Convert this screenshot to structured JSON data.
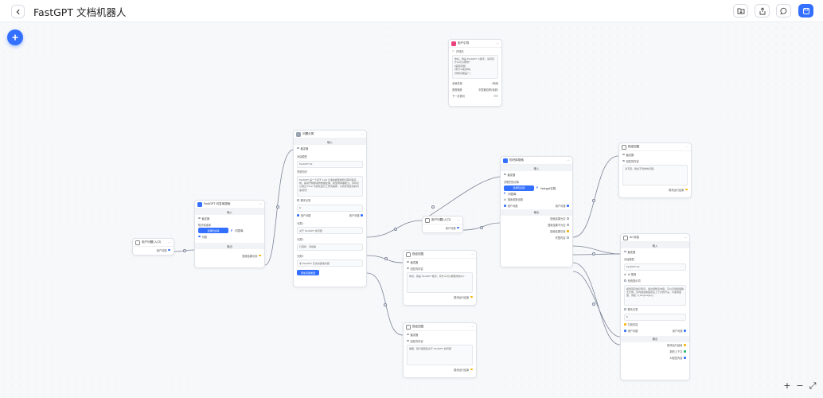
{
  "header": {
    "back_icon": "chevron-left-icon",
    "title": "FastGPT 文档机器人"
  },
  "toolbar": {
    "icons": [
      "folder-import-icon",
      "export-icon",
      "chat-icon",
      "save-icon"
    ]
  },
  "fab": {
    "icon": "plus-icon",
    "label": "+"
  },
  "nodes": {
    "user_guide": {
      "title": "用户引导",
      "greeting_label": "开场白",
      "greeting_text": "你好，我是 FastGPT 小助手，请问有什么可以帮你？\n[使用问题]\n[有什么新的吗]\n[你的功能是？]",
      "vars_label": "全局变量",
      "vars_value": "+新增",
      "tts_label": "语音播放",
      "tts_value": "浏览器自带(免费)",
      "next_label": "下一步提问"
    },
    "user_q_1": {
      "title": "用户问题(入口)",
      "out_label": "用户问题"
    },
    "kb_search_1": {
      "title": "FastGPT 问答库搜索",
      "input_section": "输入",
      "trigger_label": "触发器",
      "kb_label": "知识库选择",
      "kb_button": "选择知识库",
      "kb_tag": "问答库",
      "question_label": "问题",
      "output_section": "输出",
      "out_label": "搜索结果引用"
    },
    "classifier": {
      "title": "问题分类",
      "input_section": "输入",
      "trigger_label": "触发器",
      "model_label": "对话模型",
      "model_value": "FastGPT-4k",
      "bg_label": "背景知识",
      "bg_text": "FastGPT 是一个基于 LLM 大语言模型的知识库问答系统，提供开箱即用的数据处理、模型调用等能力。同时可以通过 Flow 可视化进行工作流编排，从而实现复杂的问答场景！",
      "history_label": "聊天记录",
      "history_value": "6",
      "question_label": "用户问题",
      "question_out": "用户问题",
      "class_label": "分类1",
      "class1": "关于 FastGPT 的问题",
      "class2_label": "分类2",
      "class2": "打招呼、问候等",
      "class3_label": "分类3",
      "class3": "非 FastGPT 无关的其他问题",
      "add_button": "添加问题类型"
    },
    "user_q_2": {
      "title": "用户问题(入口)",
      "out_label": "用户问题"
    },
    "reply_1": {
      "title": "指定回复",
      "trigger_label": "触发器",
      "content_label": "回复的内容",
      "content": "你好，我是 FastGPT 助手，有什么可以帮助你的么？",
      "out_label": "模块运行结束"
    },
    "reply_2": {
      "title": "指定回复",
      "trigger_label": "触发器",
      "content_label": "回复的内容",
      "content": "抱歉，我只能回答关于 FastGPT 的问题",
      "out_label": "模块运行结束"
    },
    "kb_search_2": {
      "title": "知识库搜索",
      "input_section": "输入",
      "trigger_label": "触发器",
      "kb_label": "关联的知识库",
      "kb_button": "选择知识库",
      "kb_tag1": "fastgpt文档",
      "kb_tag2": "问答库",
      "param_label": "搜索参数设置",
      "question_label": "用户问题",
      "question_out": "用户问题",
      "output_section": "输出",
      "out1": "搜索结果为空",
      "out2": "搜索结果不为空",
      "out3": "搜索结果引用",
      "out4": "完整内容"
    },
    "reply_3": {
      "title": "指定回复",
      "trigger_label": "触发器",
      "content_label": "回复的内容",
      "content": "对不起，我找不到你的问题。",
      "out_label": "模块运行结束"
    },
    "ai_chat": {
      "title": "AI 对话",
      "input_section": "输入",
      "trigger_label": "触发器",
      "model_label": "对话模型",
      "model_value": "FastGPT-4k",
      "ai_config": "AI 配置",
      "prompt_label": "系统提示词",
      "prompt_text": "模型固定的引导词，通过调整该内容，可以引导模型聊天方向。该内容会被固定在上下文的开头。可使用变量，例如 {{language}}",
      "history_label": "聊天记录",
      "history_value": "6",
      "quote_label": "引用内容",
      "question_label": "用户问题",
      "question_out": "用户问题",
      "output_section": "输出",
      "out1": "模块运行结束",
      "out2": "新的上下文",
      "out3": "AI回复内容"
    }
  },
  "zoom": {
    "in": "+",
    "out": "−",
    "fit": "⤢"
  },
  "colors": {
    "accent": "#3370ff",
    "edge": "#7b8597",
    "handle_yellow": "#f5b400",
    "handle_blue": "#3370ff"
  }
}
